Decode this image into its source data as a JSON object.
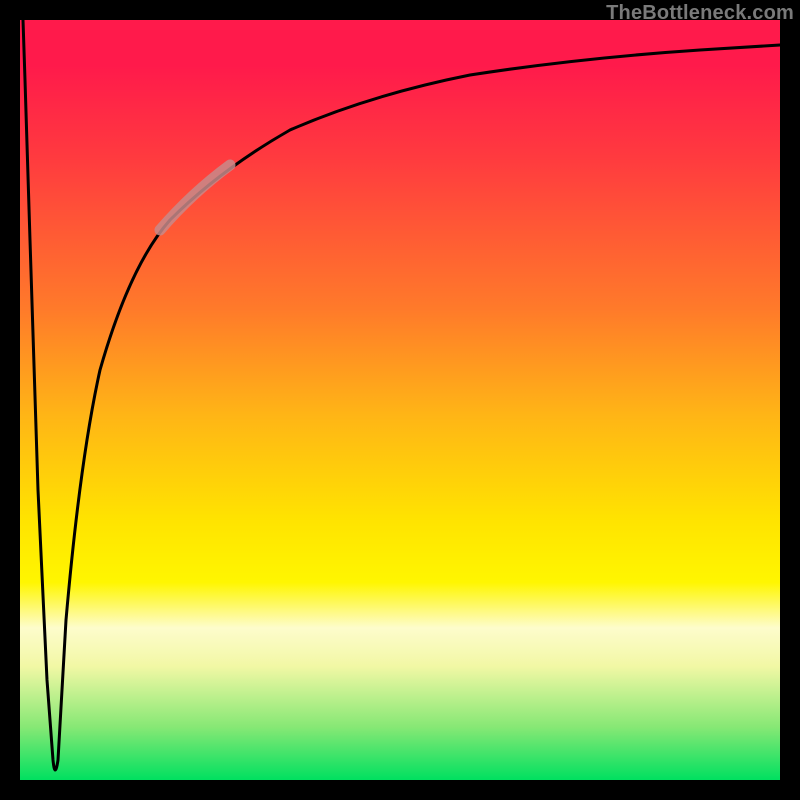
{
  "watermark": "TheBottleneck.com",
  "colors": {
    "frame": "#000000",
    "gradient_top": "#ff1a4b",
    "gradient_mid1": "#ff7a2a",
    "gradient_mid2": "#ffe400",
    "gradient_bottom": "#00e060",
    "curve": "#000000",
    "highlight": "#c88a8a"
  },
  "chart_data": {
    "type": "line",
    "title": "",
    "xlabel": "",
    "ylabel": "",
    "xlim": [
      0,
      100
    ],
    "ylim": [
      0,
      100
    ],
    "grid": false,
    "legend": false,
    "series": [
      {
        "name": "bottleneck-curve",
        "x": [
          0,
          1,
          2,
          3,
          4,
          4.5,
          5,
          6,
          8,
          10,
          12,
          15,
          18,
          22,
          27,
          33,
          40,
          50,
          60,
          72,
          85,
          100
        ],
        "y": [
          100,
          60,
          30,
          10,
          2,
          1,
          4,
          20,
          42,
          55,
          63,
          70,
          75,
          79,
          83,
          86,
          89,
          91.5,
          93,
          94.3,
          95.3,
          96
        ]
      }
    ],
    "annotations": [
      {
        "name": "highlight-segment",
        "type": "segment-overlay",
        "x_range": [
          18,
          27
        ],
        "approx_y_range": [
          75,
          83
        ],
        "color": "#c88a8a",
        "thickness_px": 8
      }
    ]
  }
}
